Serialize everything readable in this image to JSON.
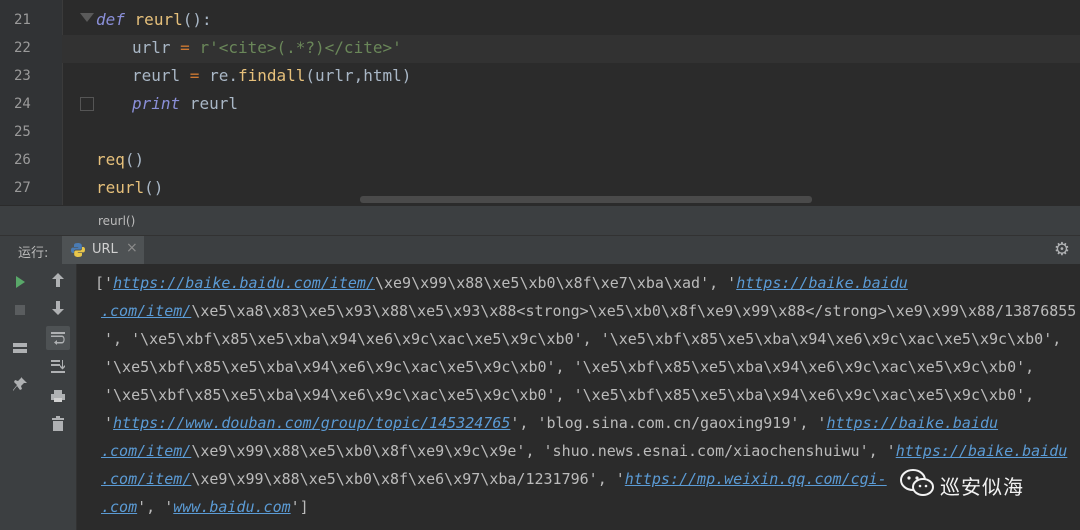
{
  "editor": {
    "line_numbers": [
      "21",
      "22",
      "23",
      "24",
      "25",
      "26",
      "27"
    ],
    "lines": {
      "l21": {
        "kw": "def",
        "name": "reurl",
        "rest": "():"
      },
      "l22": {
        "var": "urlr",
        "eq": " = ",
        "str": "r'<cite>(.*?)</cite>'"
      },
      "l23": {
        "var": "reurl",
        "eq": " = ",
        "obj": "re.",
        "method": "findall",
        "rest": "(urlr,html)"
      },
      "l24": {
        "kw": "print",
        "rest": " reurl"
      },
      "l26": {
        "call": "req",
        "rest": "()"
      },
      "l27": {
        "call": "reurl",
        "rest": "()"
      }
    },
    "breadcrumb": "reurl()"
  },
  "run_panel": {
    "label": "运行:",
    "tab_label": "URL",
    "tab_close": "×",
    "console_lines": [
      {
        "pre": "['",
        "link1": "https://baike.baidu.com/item/",
        "mid": "\\xe9\\x99\\x88\\xe5\\xb0\\x8f\\xe7\\xba\\xad', '",
        "link2": "https://baike.baidu"
      },
      {
        "pre": "",
        "link1": ".com/item/",
        "mid": "\\xe5\\xa8\\x83\\xe5\\x93\\x88\\xe5\\x93\\x88<strong>\\xe5\\xb0\\x8f\\xe9\\x99\\x88</strong>\\xe9\\x99\\x88/13876855",
        "link2": ""
      },
      {
        "pre": "', '\\xe5\\xbf\\x85\\xe5\\xba\\x94\\xe6\\x9c\\xac\\xe5\\x9c\\xb0', '\\xe5\\xbf\\x85\\xe5\\xba\\x94\\xe6\\x9c\\xac\\xe5\\x9c\\xb0',",
        "link1": "",
        "mid": "",
        "link2": ""
      },
      {
        "pre": "'\\xe5\\xbf\\x85\\xe5\\xba\\x94\\xe6\\x9c\\xac\\xe5\\x9c\\xb0', '\\xe5\\xbf\\x85\\xe5\\xba\\x94\\xe6\\x9c\\xac\\xe5\\x9c\\xb0',",
        "link1": "",
        "mid": "",
        "link2": ""
      },
      {
        "pre": "'\\xe5\\xbf\\x85\\xe5\\xba\\x94\\xe6\\x9c\\xac\\xe5\\x9c\\xb0', '\\xe5\\xbf\\x85\\xe5\\xba\\x94\\xe6\\x9c\\xac\\xe5\\x9c\\xb0',",
        "link1": "",
        "mid": "",
        "link2": ""
      },
      {
        "pre": "'",
        "link1": "https://www.douban.com/group/topic/145324765",
        "mid": "', 'blog.sina.com.cn/gaoxing919', '",
        "link2": "https://baike.baidu"
      },
      {
        "pre": "",
        "link1": ".com/item/",
        "mid": "\\xe9\\x99\\x88\\xe5\\xb0\\x8f\\xe9\\x9c\\x9e', 'shuo.news.esnai.com/xiaochenshuiwu', '",
        "link2": "https://baike.baidu"
      },
      {
        "pre": "",
        "link1": ".com/item/",
        "mid": "\\xe9\\x99\\x88\\xe5\\xb0\\x8f\\xe6\\x97\\xba/1231796', '",
        "link2": "https://mp.weixin.qq.com/cgi-"
      },
      {
        "pre": "",
        "link1": ".com",
        "mid": "', '",
        "link2": "www.baidu.com",
        "post": "']"
      }
    ]
  },
  "watermark": {
    "text": "巡安似海"
  },
  "colors": {
    "link": "#5b9bd5",
    "keyword": "#8a8fd8",
    "function": "#e6c07b",
    "operator": "#cc7832",
    "string": "#6a8759"
  }
}
